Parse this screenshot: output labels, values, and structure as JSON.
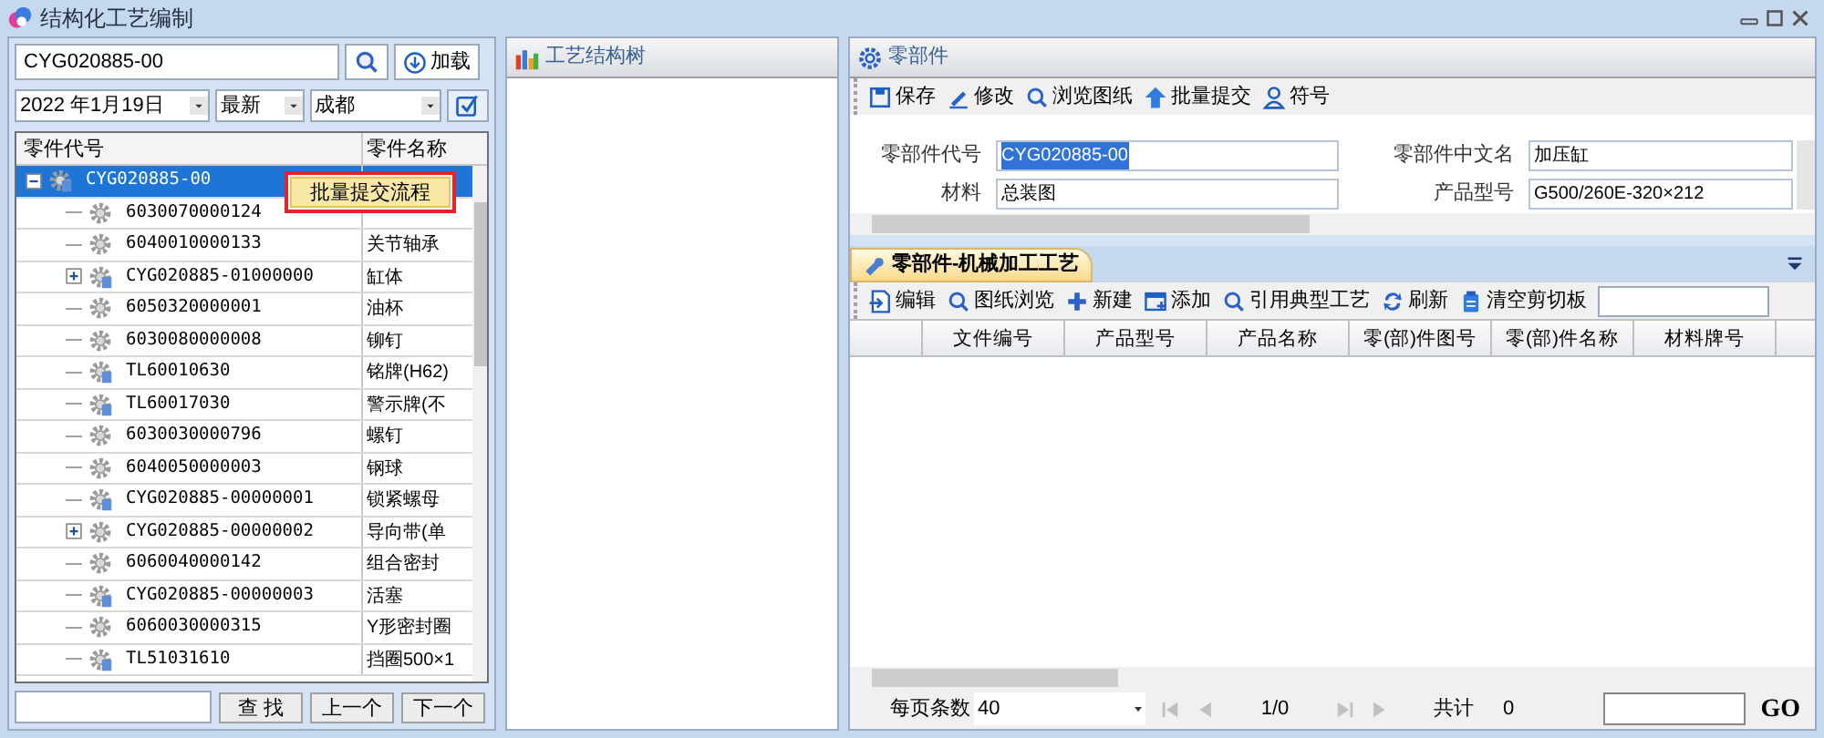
{
  "window": {
    "title": "结构化工艺编制"
  },
  "left": {
    "search_value": "CYG020885-00",
    "load_button": "加载",
    "date": "2022 年1月19日",
    "version": "最新",
    "location": "成都",
    "tree_columns": [
      "零件代号",
      "零件名称"
    ],
    "tree": [
      {
        "code": "CYG020885-00",
        "kind": "doc",
        "expanded": true,
        "selected": true,
        "children": [
          {
            "code": "6030070000124",
            "kind": "gear",
            "selected": false
          },
          {
            "code": "6040010000133",
            "name": "关节轴承",
            "kind": "gear",
            "selected": false
          },
          {
            "code": "CYG020885-01000000",
            "name": "缸体",
            "kind": "doc",
            "expanded": false,
            "selected": false
          },
          {
            "code": "6050320000001",
            "name": "油杯",
            "kind": "gear",
            "selected": false
          },
          {
            "code": "6030080000008",
            "name": "铆钉",
            "kind": "gear",
            "selected": false
          },
          {
            "code": "TL60010630",
            "name": "铭牌(H62)",
            "kind": "doc",
            "selected": false
          },
          {
            "code": "TL60017030",
            "name": "警示牌(不",
            "kind": "doc",
            "selected": false
          },
          {
            "code": "6030030000796",
            "name": "螺钉",
            "kind": "gear",
            "selected": false
          },
          {
            "code": "6040050000003",
            "name": "钢球",
            "kind": "gear",
            "selected": false
          },
          {
            "code": "CYG020885-00000001",
            "name": "锁紧螺母",
            "kind": "doc",
            "selected": false
          },
          {
            "code": "CYG020885-00000002",
            "name": "导向带(单",
            "kind": "gear",
            "expanded": false,
            "selected": false
          },
          {
            "code": "6060040000142",
            "name": "组合密封",
            "kind": "gear",
            "selected": false
          },
          {
            "code": "CYG020885-00000003",
            "name": "活塞",
            "kind": "doc",
            "selected": false
          },
          {
            "code": "6060030000315",
            "name": "Y形密封圈",
            "kind": "gear",
            "selected": false
          },
          {
            "code": "TL51031610",
            "name": "挡圈500×1",
            "kind": "doc",
            "selected": false
          }
        ]
      }
    ],
    "context_menu": {
      "item": "批量提交流程"
    },
    "find_buttons": [
      "查 找",
      "上一个",
      "下一个"
    ]
  },
  "middle": {
    "title": "工艺结构树"
  },
  "parts": {
    "title": "零部件",
    "toolbar": [
      {
        "label": "保存",
        "kind": "save"
      },
      {
        "label": "修改",
        "kind": "pen"
      },
      {
        "label": "浏览图纸",
        "kind": "search"
      },
      {
        "label": "批量提交",
        "kind": "up"
      },
      {
        "label": "符号",
        "kind": "user"
      }
    ],
    "fields": [
      {
        "label": "零部件代号",
        "value": "CYG020885-00",
        "selected": true
      },
      {
        "label": "零部件中文名",
        "value": "加压缸",
        "selected": false
      },
      {
        "label": "材料",
        "value": "总装图",
        "selected": false
      },
      {
        "label": "产品型号",
        "value": "G500/260E-320×212",
        "selected": false
      }
    ]
  },
  "process": {
    "tab": "零部件-机械加工工艺",
    "toolbar": [
      {
        "label": "编辑",
        "kind": "edit"
      },
      {
        "label": "图纸浏览",
        "kind": "search"
      },
      {
        "label": "新建",
        "kind": "plus"
      },
      {
        "label": "添加",
        "kind": "add"
      },
      {
        "label": "引用典型工艺",
        "kind": "search"
      },
      {
        "label": "刷新",
        "kind": "refresh"
      },
      {
        "label": "清空剪切板",
        "kind": "clip"
      }
    ],
    "columns": [
      "文件编号",
      "产品型号",
      "产品名称",
      "零(部)件图号",
      "零(部)件名称",
      "材料牌号"
    ],
    "pager": {
      "page_size_label": "每页条数",
      "page_size": "40",
      "page": "1/0",
      "total_label": "共计",
      "total": "0",
      "go": "GO"
    }
  }
}
